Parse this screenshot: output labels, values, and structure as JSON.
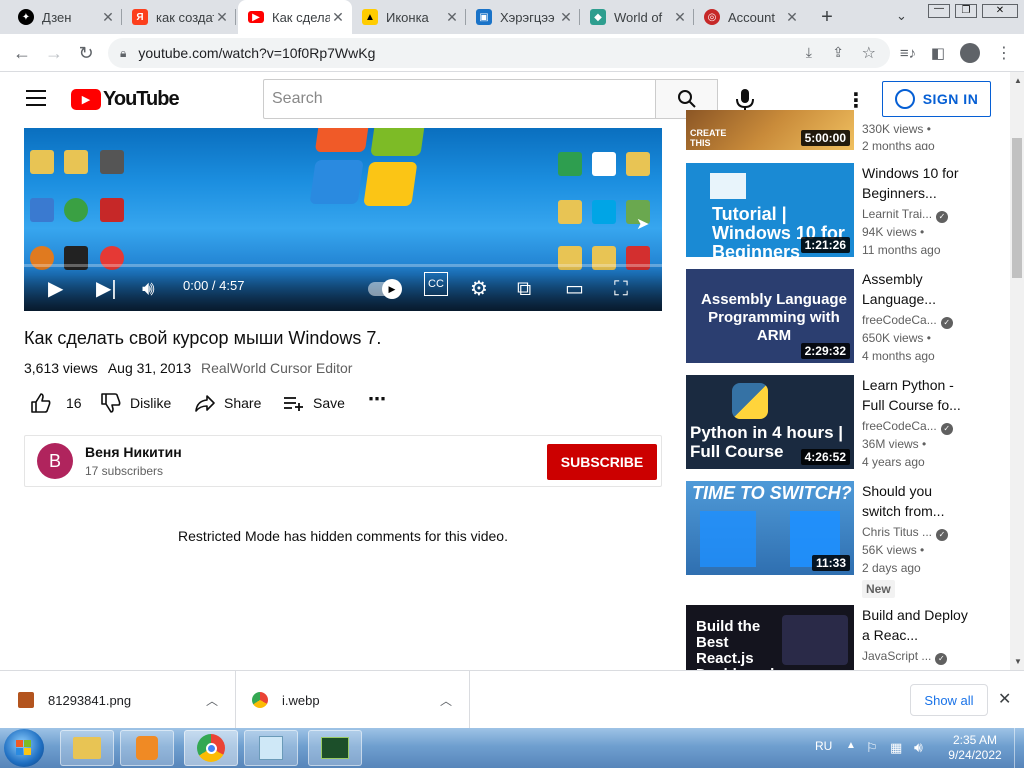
{
  "browser": {
    "tabs": [
      {
        "label": "Дзен",
        "icon": "dzen-icon"
      },
      {
        "label": "как создать",
        "icon": "yandex-icon"
      },
      {
        "label": "Как сделать",
        "icon": "youtube-icon",
        "active": true
      },
      {
        "label": "Иконка",
        "icon": "image-icon"
      },
      {
        "label": "Хэрэгцээ",
        "icon": "image-icon"
      },
      {
        "label": "World of",
        "icon": "shield-icon"
      },
      {
        "label": "Account",
        "icon": "opera-icon"
      }
    ],
    "url": "youtube.com/watch?v=10f0Rp7WwKg"
  },
  "youtube": {
    "logo_text": "YouTube",
    "search_placeholder": "Search",
    "sign_in": "SIGN IN"
  },
  "player": {
    "time": "0:00 / 4:57"
  },
  "video": {
    "title": "Как сделать свой курсор мыши Windows 7.",
    "views": "3,613 views",
    "date": "Aug 31, 2013",
    "tag": "RealWorld Cursor Editor",
    "likes": "16",
    "dislike": "Dislike",
    "share": "Share",
    "save": "Save"
  },
  "channel": {
    "avatar_letter": "B",
    "name": "Веня Никитин",
    "subscribers": "17 subscribers",
    "subscribe": "SUBSCRIBE"
  },
  "comments_notice": "Restricted Mode has hidden comments for this video.",
  "recommendations": [
    {
      "thumb_text": "CREATE THIS",
      "duration": "5:00:00",
      "title": "",
      "channel": "",
      "views": "330K views •",
      "age": "2 months ago",
      "partial": true
    },
    {
      "thumb_text": "Tutorial | Windows 10 for Beginners",
      "duration": "1:21:26",
      "title": "Windows 10 for Beginners...",
      "channel": "Learnit Trai...",
      "views": "94K views •",
      "age": "11 months ago"
    },
    {
      "thumb_text": "Assembly Language Programming with ARM",
      "duration": "2:29:32",
      "title": "Assembly Language...",
      "channel": "freeCodeCa...",
      "views": "650K views •",
      "age": "4 months ago"
    },
    {
      "thumb_text": "Python in 4 hours | Full Course",
      "duration": "4:26:52",
      "title": "Learn Python - Full Course fo...",
      "channel": "freeCodeCa...",
      "views": "36M views •",
      "age": "4 years ago"
    },
    {
      "thumb_text": "TIME TO SWITCH?",
      "duration": "11:33",
      "title": "Should you switch from...",
      "channel": "Chris Titus ...",
      "views": "56K views •",
      "age": "2 days ago",
      "badge": "New"
    },
    {
      "thumb_text": "Build the Best React.js Dashboard",
      "duration": "",
      "title": "Build and Deploy a Reac...",
      "channel": "JavaScript ...",
      "views": "",
      "age": ""
    }
  ],
  "downloads": {
    "items": [
      "81293841.png",
      "i.webp"
    ],
    "show_all": "Show all"
  },
  "taskbar": {
    "lang": "RU",
    "time": "2:35 AM",
    "date": "9/24/2022"
  },
  "colors": {
    "youtube_red": "#ff0000",
    "subscribe_red": "#cc0000",
    "link_blue": "#065fd4",
    "avatar_purple": "#b0245d"
  }
}
